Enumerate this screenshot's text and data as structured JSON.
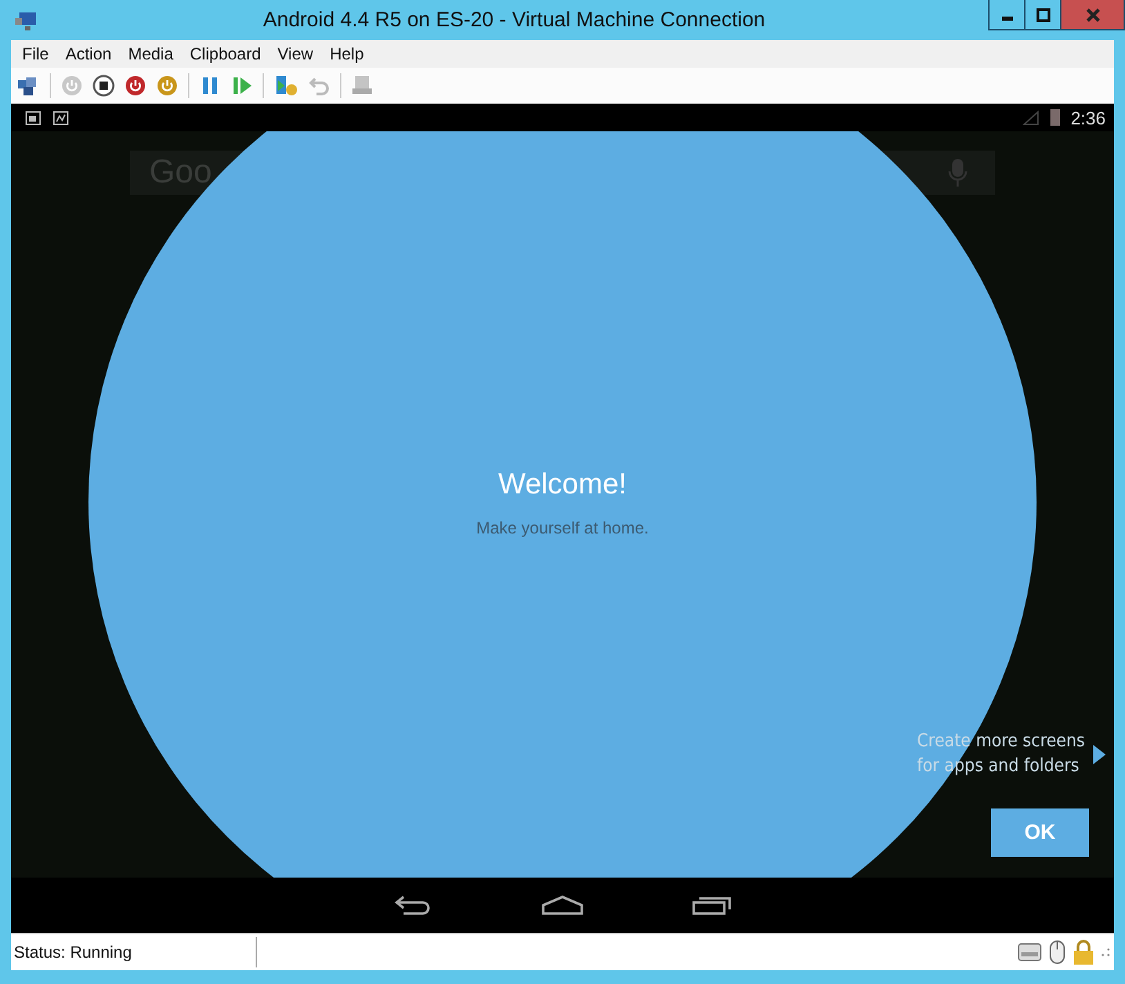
{
  "window": {
    "title": "Android 4.4 R5 on ES-20 - Virtual Machine Connection"
  },
  "menu": [
    "File",
    "Action",
    "Media",
    "Clipboard",
    "View",
    "Help"
  ],
  "device": {
    "clock": "2:36",
    "search_text": "Goo",
    "welcome_title": "Welcome!",
    "welcome_subtitle": "Make yourself at home.",
    "hint": "Create more screens\nfor apps and folders",
    "ok_button": "OK"
  },
  "status_bar": {
    "status": "Status: Running"
  }
}
